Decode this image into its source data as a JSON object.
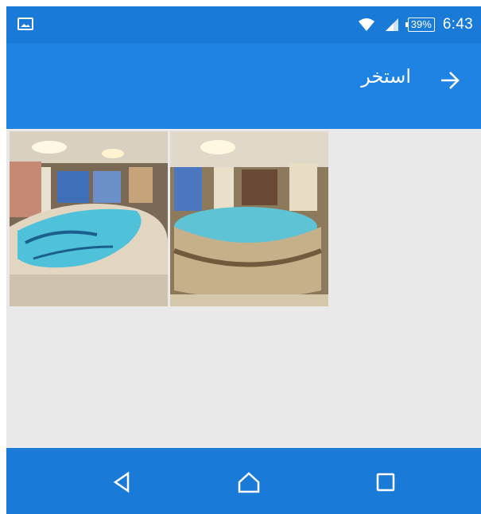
{
  "status_bar": {
    "notification_icon": "image-icon",
    "wifi_icon": "wifi-icon",
    "signal_icon": "signal-icon",
    "battery_text": "39%",
    "time": "6:43"
  },
  "app_bar": {
    "title": "استخر",
    "back_icon": "arrow-right-icon",
    "background": "#1f83e4"
  },
  "gallery": {
    "items": [
      {
        "icon": "pool-photo-1"
      },
      {
        "icon": "pool-photo-2"
      }
    ]
  },
  "nav_bar": {
    "back_icon": "triangle-back-icon",
    "home_icon": "home-icon",
    "recent_icon": "square-recent-icon",
    "background": "#1a7ad8"
  }
}
